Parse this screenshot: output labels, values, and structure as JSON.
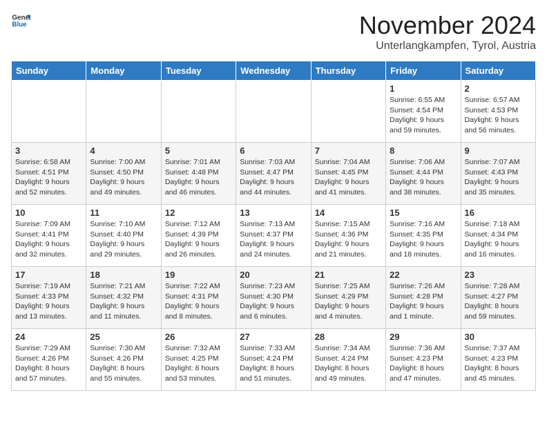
{
  "header": {
    "logo_general": "General",
    "logo_blue": "Blue",
    "month": "November 2024",
    "location": "Unterlangkampfen, Tyrol, Austria"
  },
  "days_of_week": [
    "Sunday",
    "Monday",
    "Tuesday",
    "Wednesday",
    "Thursday",
    "Friday",
    "Saturday"
  ],
  "weeks": [
    [
      {
        "day": "",
        "info": ""
      },
      {
        "day": "",
        "info": ""
      },
      {
        "day": "",
        "info": ""
      },
      {
        "day": "",
        "info": ""
      },
      {
        "day": "",
        "info": ""
      },
      {
        "day": "1",
        "info": "Sunrise: 6:55 AM\nSunset: 4:54 PM\nDaylight: 9 hours\nand 59 minutes."
      },
      {
        "day": "2",
        "info": "Sunrise: 6:57 AM\nSunset: 4:53 PM\nDaylight: 9 hours\nand 56 minutes."
      }
    ],
    [
      {
        "day": "3",
        "info": "Sunrise: 6:58 AM\nSunset: 4:51 PM\nDaylight: 9 hours\nand 52 minutes."
      },
      {
        "day": "4",
        "info": "Sunrise: 7:00 AM\nSunset: 4:50 PM\nDaylight: 9 hours\nand 49 minutes."
      },
      {
        "day": "5",
        "info": "Sunrise: 7:01 AM\nSunset: 4:48 PM\nDaylight: 9 hours\nand 46 minutes."
      },
      {
        "day": "6",
        "info": "Sunrise: 7:03 AM\nSunset: 4:47 PM\nDaylight: 9 hours\nand 44 minutes."
      },
      {
        "day": "7",
        "info": "Sunrise: 7:04 AM\nSunset: 4:45 PM\nDaylight: 9 hours\nand 41 minutes."
      },
      {
        "day": "8",
        "info": "Sunrise: 7:06 AM\nSunset: 4:44 PM\nDaylight: 9 hours\nand 38 minutes."
      },
      {
        "day": "9",
        "info": "Sunrise: 7:07 AM\nSunset: 4:43 PM\nDaylight: 9 hours\nand 35 minutes."
      }
    ],
    [
      {
        "day": "10",
        "info": "Sunrise: 7:09 AM\nSunset: 4:41 PM\nDaylight: 9 hours\nand 32 minutes."
      },
      {
        "day": "11",
        "info": "Sunrise: 7:10 AM\nSunset: 4:40 PM\nDaylight: 9 hours\nand 29 minutes."
      },
      {
        "day": "12",
        "info": "Sunrise: 7:12 AM\nSunset: 4:39 PM\nDaylight: 9 hours\nand 26 minutes."
      },
      {
        "day": "13",
        "info": "Sunrise: 7:13 AM\nSunset: 4:37 PM\nDaylight: 9 hours\nand 24 minutes."
      },
      {
        "day": "14",
        "info": "Sunrise: 7:15 AM\nSunset: 4:36 PM\nDaylight: 9 hours\nand 21 minutes."
      },
      {
        "day": "15",
        "info": "Sunrise: 7:16 AM\nSunset: 4:35 PM\nDaylight: 9 hours\nand 18 minutes."
      },
      {
        "day": "16",
        "info": "Sunrise: 7:18 AM\nSunset: 4:34 PM\nDaylight: 9 hours\nand 16 minutes."
      }
    ],
    [
      {
        "day": "17",
        "info": "Sunrise: 7:19 AM\nSunset: 4:33 PM\nDaylight: 9 hours\nand 13 minutes."
      },
      {
        "day": "18",
        "info": "Sunrise: 7:21 AM\nSunset: 4:32 PM\nDaylight: 9 hours\nand 11 minutes."
      },
      {
        "day": "19",
        "info": "Sunrise: 7:22 AM\nSunset: 4:31 PM\nDaylight: 9 hours\nand 8 minutes."
      },
      {
        "day": "20",
        "info": "Sunrise: 7:23 AM\nSunset: 4:30 PM\nDaylight: 9 hours\nand 6 minutes."
      },
      {
        "day": "21",
        "info": "Sunrise: 7:25 AM\nSunset: 4:29 PM\nDaylight: 9 hours\nand 4 minutes."
      },
      {
        "day": "22",
        "info": "Sunrise: 7:26 AM\nSunset: 4:28 PM\nDaylight: 9 hours\nand 1 minute."
      },
      {
        "day": "23",
        "info": "Sunrise: 7:28 AM\nSunset: 4:27 PM\nDaylight: 8 hours\nand 59 minutes."
      }
    ],
    [
      {
        "day": "24",
        "info": "Sunrise: 7:29 AM\nSunset: 4:26 PM\nDaylight: 8 hours\nand 57 minutes."
      },
      {
        "day": "25",
        "info": "Sunrise: 7:30 AM\nSunset: 4:26 PM\nDaylight: 8 hours\nand 55 minutes."
      },
      {
        "day": "26",
        "info": "Sunrise: 7:32 AM\nSunset: 4:25 PM\nDaylight: 8 hours\nand 53 minutes."
      },
      {
        "day": "27",
        "info": "Sunrise: 7:33 AM\nSunset: 4:24 PM\nDaylight: 8 hours\nand 51 minutes."
      },
      {
        "day": "28",
        "info": "Sunrise: 7:34 AM\nSunset: 4:24 PM\nDaylight: 8 hours\nand 49 minutes."
      },
      {
        "day": "29",
        "info": "Sunrise: 7:36 AM\nSunset: 4:23 PM\nDaylight: 8 hours\nand 47 minutes."
      },
      {
        "day": "30",
        "info": "Sunrise: 7:37 AM\nSunset: 4:23 PM\nDaylight: 8 hours\nand 45 minutes."
      }
    ]
  ]
}
